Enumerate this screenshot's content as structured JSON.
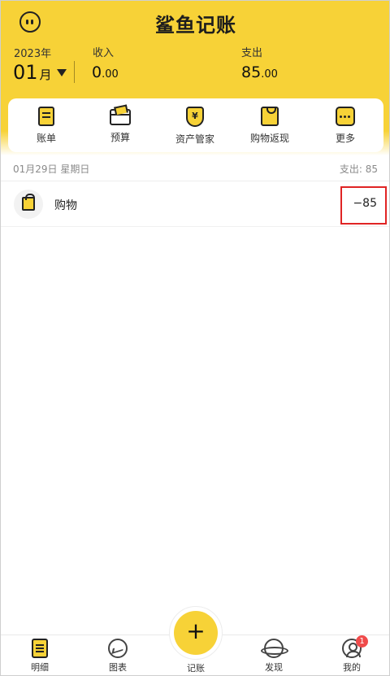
{
  "header": {
    "app_title": "鲨鱼记账",
    "year": "2023年",
    "month_num": "01",
    "month_unit": "月",
    "income_label": "收入",
    "income_int": "0",
    "income_dec": ".00",
    "expense_label": "支出",
    "expense_int": "85",
    "expense_dec": ".00"
  },
  "shortcuts": [
    {
      "label": "账单",
      "icon": "bill-icon"
    },
    {
      "label": "预算",
      "icon": "wallet-icon"
    },
    {
      "label": "资产管家",
      "icon": "shield-yen-icon",
      "glyph": "¥"
    },
    {
      "label": "购物返现",
      "icon": "shopping-bag-icon"
    },
    {
      "label": "更多",
      "icon": "more-icon"
    }
  ],
  "day": {
    "date": "01月29日 星期日",
    "summary": "支出: 85"
  },
  "records": [
    {
      "category": "购物",
      "amount": "−85",
      "icon": "shopping-bag-icon"
    }
  ],
  "bottom_nav": {
    "detail": "明细",
    "chart": "图表",
    "add": "记账",
    "add_glyph": "+",
    "discover": "发现",
    "me": "我的",
    "badge_count": "1"
  },
  "colors": {
    "accent": "#f7d237",
    "highlight_box": "#e02424",
    "badge": "#f04b4b"
  }
}
